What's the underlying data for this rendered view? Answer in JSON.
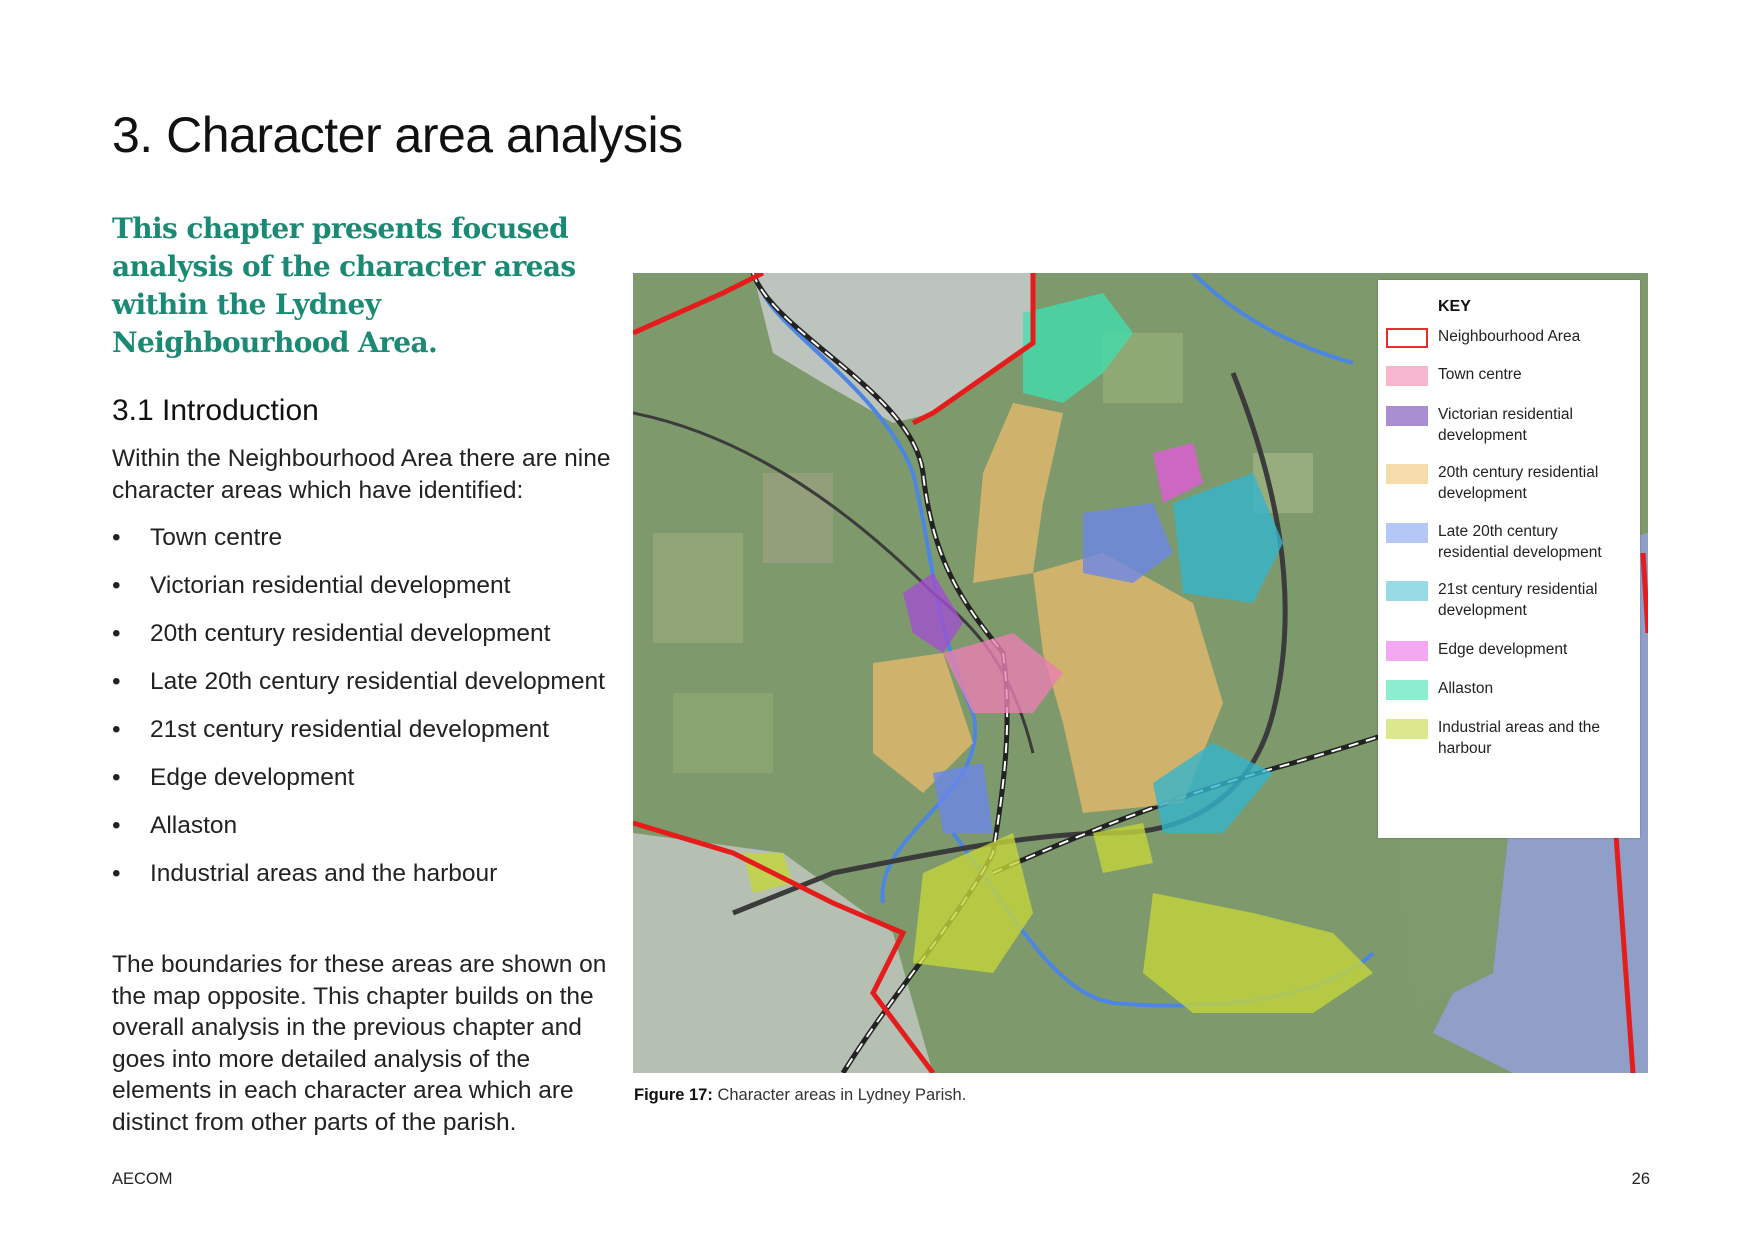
{
  "page": {
    "title": "3. Character area analysis",
    "lead": "This chapter presents focused analysis of the character areas within the Lydney Neighbourhood Area.",
    "section_heading": "3.1 Introduction",
    "intro_text": "Within the Neighbourhood Area there are nine character areas which have identified:",
    "bullets": [
      "Town centre",
      "Victorian residential development",
      "20th century residential development",
      "Late 20th century residential development",
      "21st century residential development",
      "Edge development",
      "Allaston",
      "Industrial areas and the harbour"
    ],
    "outro_text": "The boundaries for these areas are shown on the map opposite. This chapter builds on the overall analysis in the previous chapter and goes into more detailed analysis of the elements in each character area which are distinct from other parts of the parish."
  },
  "figure": {
    "caption_label": "Figure 17:",
    "caption_text": "Character areas in Lydney Parish.",
    "key": {
      "title": "KEY",
      "items": [
        {
          "label": "Neighbourhood Area",
          "color": "#e03030",
          "outline": true
        },
        {
          "label": "Town centre",
          "color": "#f7b6cf"
        },
        {
          "label": "Victorian residential development",
          "color": "#a98fcf"
        },
        {
          "label": "20th century residential development",
          "color": "#f6dcaa"
        },
        {
          "label": "Late 20th century residential development",
          "color": "#b3c8f5"
        },
        {
          "label": "21st century residential development",
          "color": "#97dbe6"
        },
        {
          "label": "Edge development",
          "color": "#f4a8f2"
        },
        {
          "label": "Allaston",
          "color": "#8deecf"
        },
        {
          "label": "Industrial areas and the harbour",
          "color": "#dbe88e"
        }
      ]
    }
  },
  "footer": {
    "brand": "AECOM",
    "page_number": "26"
  }
}
